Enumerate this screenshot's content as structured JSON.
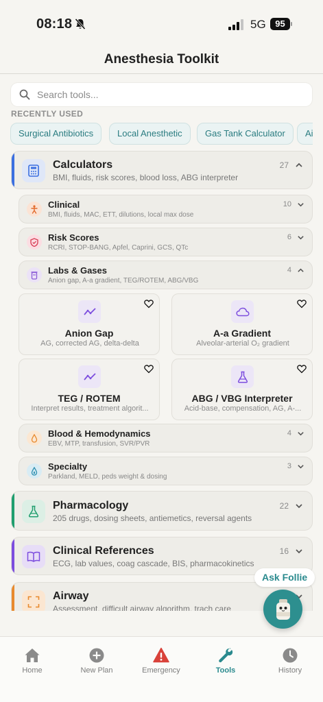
{
  "status_bar": {
    "time": "08:18",
    "network": "5G",
    "battery": "95"
  },
  "header": {
    "title": "Anesthesia Toolkit"
  },
  "search": {
    "placeholder": "Search tools..."
  },
  "recent": {
    "label": "RECENTLY USED",
    "chips": [
      "Surgical Antibiotics",
      "Local Anesthetic",
      "Gas Tank Calculator",
      "Ai"
    ]
  },
  "categories": {
    "calculators": {
      "title": "Calculators",
      "subtitle": "BMI, fluids, risk scores, blood loss, ABG interpreter",
      "count": "27",
      "accent": "#3b6fe0",
      "expanded": true
    },
    "pharmacology": {
      "title": "Pharmacology",
      "subtitle": "205 drugs, dosing sheets, antiemetics, reversal agents",
      "count": "22",
      "accent": "#1f9e6e"
    },
    "references": {
      "title": "Clinical References",
      "subtitle": "ECG, lab values, coag cascade, BIS, pharmacokinetics",
      "count": "16",
      "accent": "#7c4dde"
    },
    "airway": {
      "title": "Airway",
      "subtitle": "Assessment, difficult airway algorithm, trach care",
      "accent": "#e88a2e"
    }
  },
  "subcategories": {
    "clinical": {
      "title": "Clinical",
      "desc": "BMI, fluids, MAC, ETT, dilutions, local max dose",
      "count": "10"
    },
    "risk": {
      "title": "Risk Scores",
      "desc": "RCRI, STOP-BANG, Apfel, Caprini, GCS, QTc",
      "count": "6"
    },
    "labs": {
      "title": "Labs & Gases",
      "desc": "Anion gap, A-a gradient, TEG/ROTEM, ABG/VBG",
      "count": "4",
      "expanded": true
    },
    "blood": {
      "title": "Blood & Hemodynamics",
      "desc": "EBV, MTP, transfusion, SVR/PVR",
      "count": "4"
    },
    "specialty": {
      "title": "Specialty",
      "desc": "Parkland, MELD, peds weight & dosing",
      "count": "3"
    }
  },
  "tools": [
    {
      "title": "Anion Gap",
      "desc": "AG, corrected AG, delta-delta",
      "icon": "trend-icon"
    },
    {
      "title": "A-a Gradient",
      "desc": "Alveolar-arterial O₂ gradient",
      "icon": "cloud-icon"
    },
    {
      "title": "TEG / ROTEM",
      "desc": "Interpret results, treatment algorit...",
      "icon": "trend-icon"
    },
    {
      "title": "ABG / VBG Interpreter",
      "desc": "Acid-base, compensation, AG, A-...",
      "icon": "flask-icon"
    }
  ],
  "assistant": {
    "label": "Ask Follie"
  },
  "nav": {
    "items": [
      {
        "label": "Home",
        "icon": "home-icon"
      },
      {
        "label": "New Plan",
        "icon": "plus-circle-icon"
      },
      {
        "label": "Emergency",
        "icon": "warning-icon"
      },
      {
        "label": "Tools",
        "icon": "wrench-icon",
        "active": true
      },
      {
        "label": "History",
        "icon": "clock-icon"
      }
    ]
  },
  "colors": {
    "teal": "#2a8a8e",
    "purple": "#7c4dde",
    "blue": "#3b6fe0",
    "green": "#1f9e6e",
    "orange": "#e88a2e",
    "emergency": "#d9423a"
  }
}
